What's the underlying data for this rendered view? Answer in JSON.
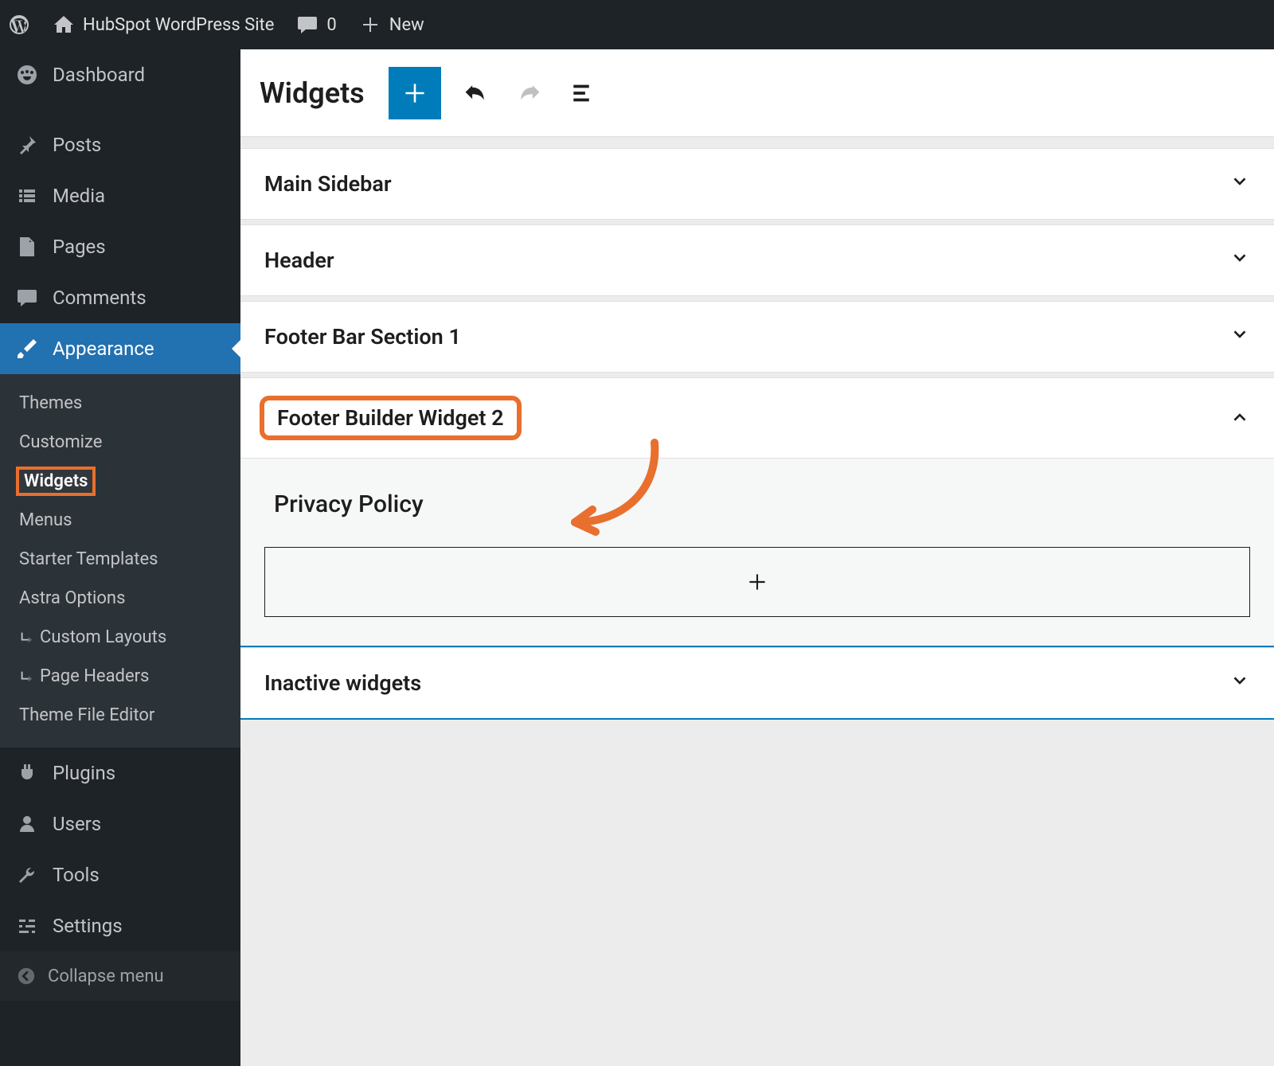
{
  "adminbar": {
    "site_title": "HubSpot WordPress Site",
    "comment_count": "0",
    "new_label": "New"
  },
  "sidebar": {
    "items": [
      {
        "icon": "dashboard",
        "label": "Dashboard"
      },
      {
        "icon": "pin",
        "label": "Posts"
      },
      {
        "icon": "media",
        "label": "Media"
      },
      {
        "icon": "pages",
        "label": "Pages"
      },
      {
        "icon": "comment",
        "label": "Comments"
      },
      {
        "icon": "brush",
        "label": "Appearance"
      },
      {
        "icon": "plugin",
        "label": "Plugins"
      },
      {
        "icon": "user",
        "label": "Users"
      },
      {
        "icon": "wrench",
        "label": "Tools"
      },
      {
        "icon": "sliders",
        "label": "Settings"
      }
    ],
    "appearance_sub": [
      "Themes",
      "Customize",
      "Widgets",
      "Menus",
      "Starter Templates",
      "Astra Options",
      "Custom Layouts",
      "Page Headers",
      "Theme File Editor"
    ],
    "collapse": "Collapse menu"
  },
  "toolbar": {
    "title": "Widgets"
  },
  "panels": {
    "p0": "Main Sidebar",
    "p1": "Header",
    "p2": "Footer Bar Section 1",
    "p3": "Footer Builder Widget 2",
    "p4": "Inactive widgets",
    "block_heading": "Privacy Policy"
  },
  "colors": {
    "accent": "#007cba",
    "highlight": "#e86f2e"
  }
}
